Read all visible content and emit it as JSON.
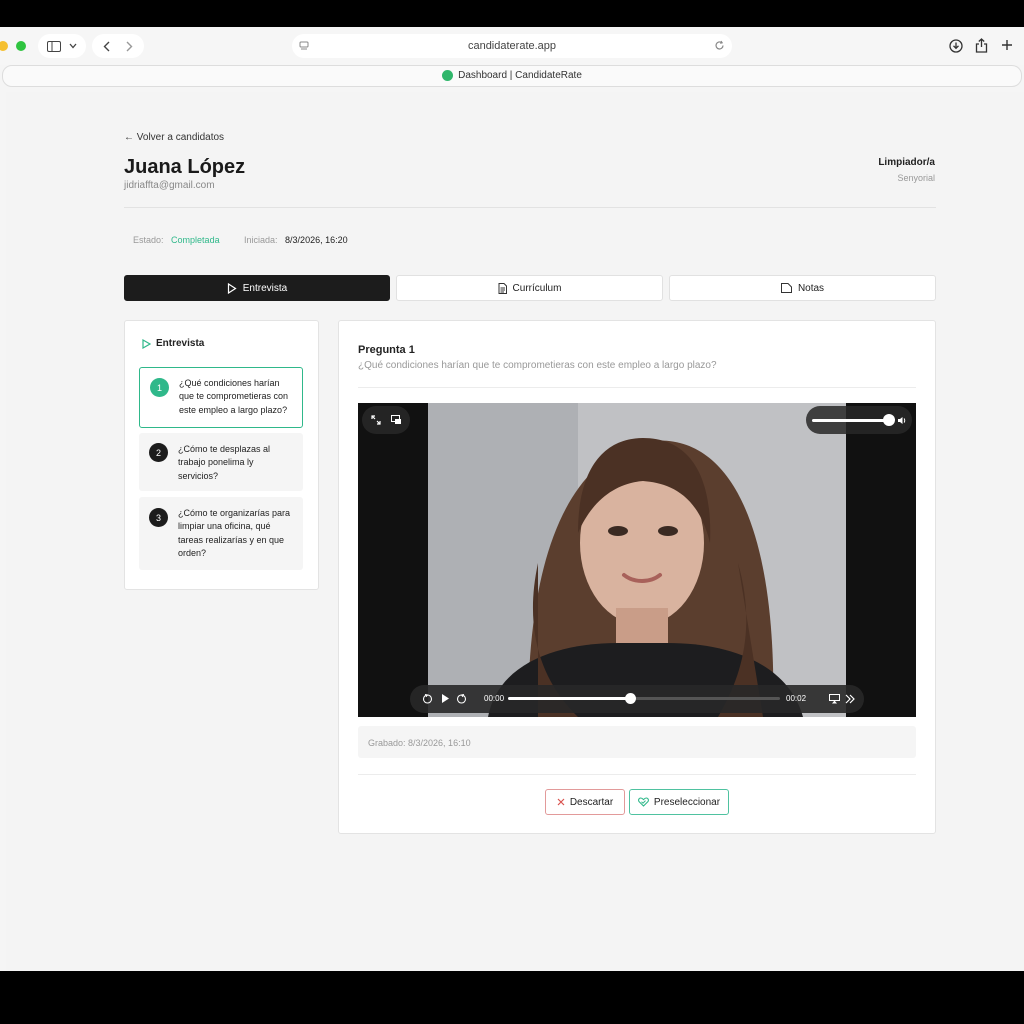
{
  "browser": {
    "url": "candidaterate.app",
    "tab_title": "Dashboard | CandidateRate"
  },
  "header": {
    "back_label": "Volver a candidatos",
    "candidate_name": "Juana López",
    "candidate_email": "jidriaffta@gmail.com",
    "role_title": "Limpiador/a",
    "role_level": "Senyorial"
  },
  "meta": {
    "status_label": "Estado:",
    "status_value": "Completada",
    "started_label": "Iniciada:",
    "started_value": "8/3/2026, 16:20"
  },
  "tabs": [
    {
      "label": "Entrevista",
      "icon": "play-icon",
      "active": true
    },
    {
      "label": "Currículum",
      "icon": "document-icon",
      "active": false
    },
    {
      "label": "Notas",
      "icon": "note-icon",
      "active": false
    }
  ],
  "sidebar": {
    "title": "Entrevista",
    "questions": [
      {
        "number": "1",
        "text": "¿Qué condiciones harían que te comprometieras con este empleo a largo plazo?"
      },
      {
        "number": "2",
        "text": "¿Cómo te desplazas al trabajo ponelima ly servicios?"
      },
      {
        "number": "3",
        "text": "¿Cómo te organizarías para limpiar una oficina, qué tareas realizarías y en que orden?"
      }
    ]
  },
  "question": {
    "title": "Pregunta 1",
    "text": "¿Qué condiciones harían que te comprometieras con este empleo a largo plazo?"
  },
  "player": {
    "current_time": "00:00",
    "duration": "00:02",
    "progress": 0.45,
    "volume": 0.9
  },
  "recorded_label": "Grabado: 8/3/2026, 16:10",
  "actions": {
    "discard_label": "Descartar",
    "shortlist_label": "Preseleccionar"
  },
  "colors": {
    "accent_green": "#2fb88a",
    "discard_red": "#e29a9a",
    "active_tab": "#1c1c1c"
  }
}
